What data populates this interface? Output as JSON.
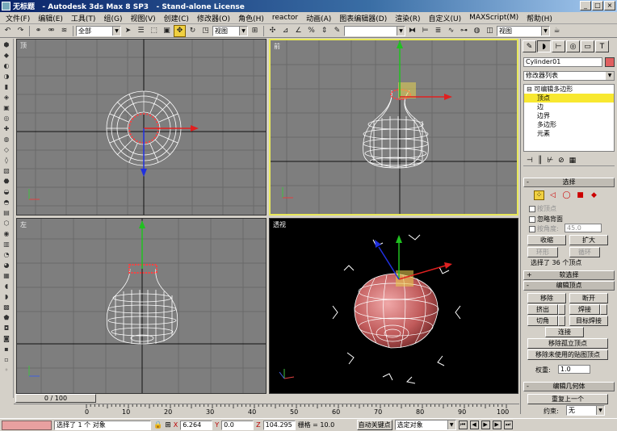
{
  "window": {
    "title": "无标题   - Autodesk 3ds Max 8 SP3   - Stand-alone License"
  },
  "menu": [
    "文件(F)",
    "编辑(E)",
    "工具(T)",
    "组(G)",
    "视图(V)",
    "创建(C)",
    "修改器(O)",
    "角色(H)",
    "reactor",
    "动画(A)",
    "图表编辑器(D)",
    "渲染(R)",
    "自定义(U)",
    "MAXScript(M)",
    "帮助(H)"
  ],
  "toolbar": {
    "selection_filter": "全部",
    "ref_coord": "视图",
    "named_selection": "",
    "view_combo": "视图"
  },
  "viewports": {
    "top": "顶",
    "front": "前",
    "left": "左",
    "perspective": "透视"
  },
  "command_panel": {
    "object_name": "Cylinder01",
    "object_color": "#e06060",
    "modifier_list": "修改器列表",
    "stack": {
      "root": "可编辑多边形",
      "items": [
        "顶点",
        "边",
        "边界",
        "多边形",
        "元素"
      ],
      "selected": "顶点"
    },
    "selection": {
      "title": "选择",
      "by_vertex": "按顶点",
      "ignore_backfacing": "忽略背面",
      "by_angle": "按角度:",
      "angle_value": "45.0",
      "shrink": "收缩",
      "grow": "扩大",
      "ring": "环形",
      "loop": "循环",
      "status": "选择了 36 个顶点"
    },
    "soft_selection": {
      "title": "软选择"
    },
    "edit_vertices": {
      "title": "编辑顶点",
      "remove": "移除",
      "break": "断开",
      "extrude": "挤出",
      "weld": "焊接",
      "chamfer": "切角",
      "target_weld": "目标焊接",
      "connect": "连接",
      "remove_isolated": "移除孤立顶点",
      "remove_unused_map": "移除未使用的贴图顶点",
      "weight_label": "权重:",
      "weight_value": "1.0"
    },
    "edit_geometry": {
      "title": "编辑几何体",
      "repeat_last": "重复上一个",
      "constraints_label": "约束:",
      "constraints_value": "无"
    }
  },
  "timeline": {
    "frame": "0 / 100",
    "ticks": [
      "0",
      "10",
      "20",
      "30",
      "40",
      "50",
      "60",
      "70",
      "80",
      "90",
      "100"
    ]
  },
  "status": {
    "selected": "选择了 1 个 对象",
    "x_label": "X",
    "x": "6.264",
    "y_label": "Y",
    "y": "0.0",
    "z_label": "Z",
    "z": "104.295",
    "grid": "栅格 = 10.0",
    "auto_key": "自动关键点",
    "key_filter": "选定对象"
  }
}
